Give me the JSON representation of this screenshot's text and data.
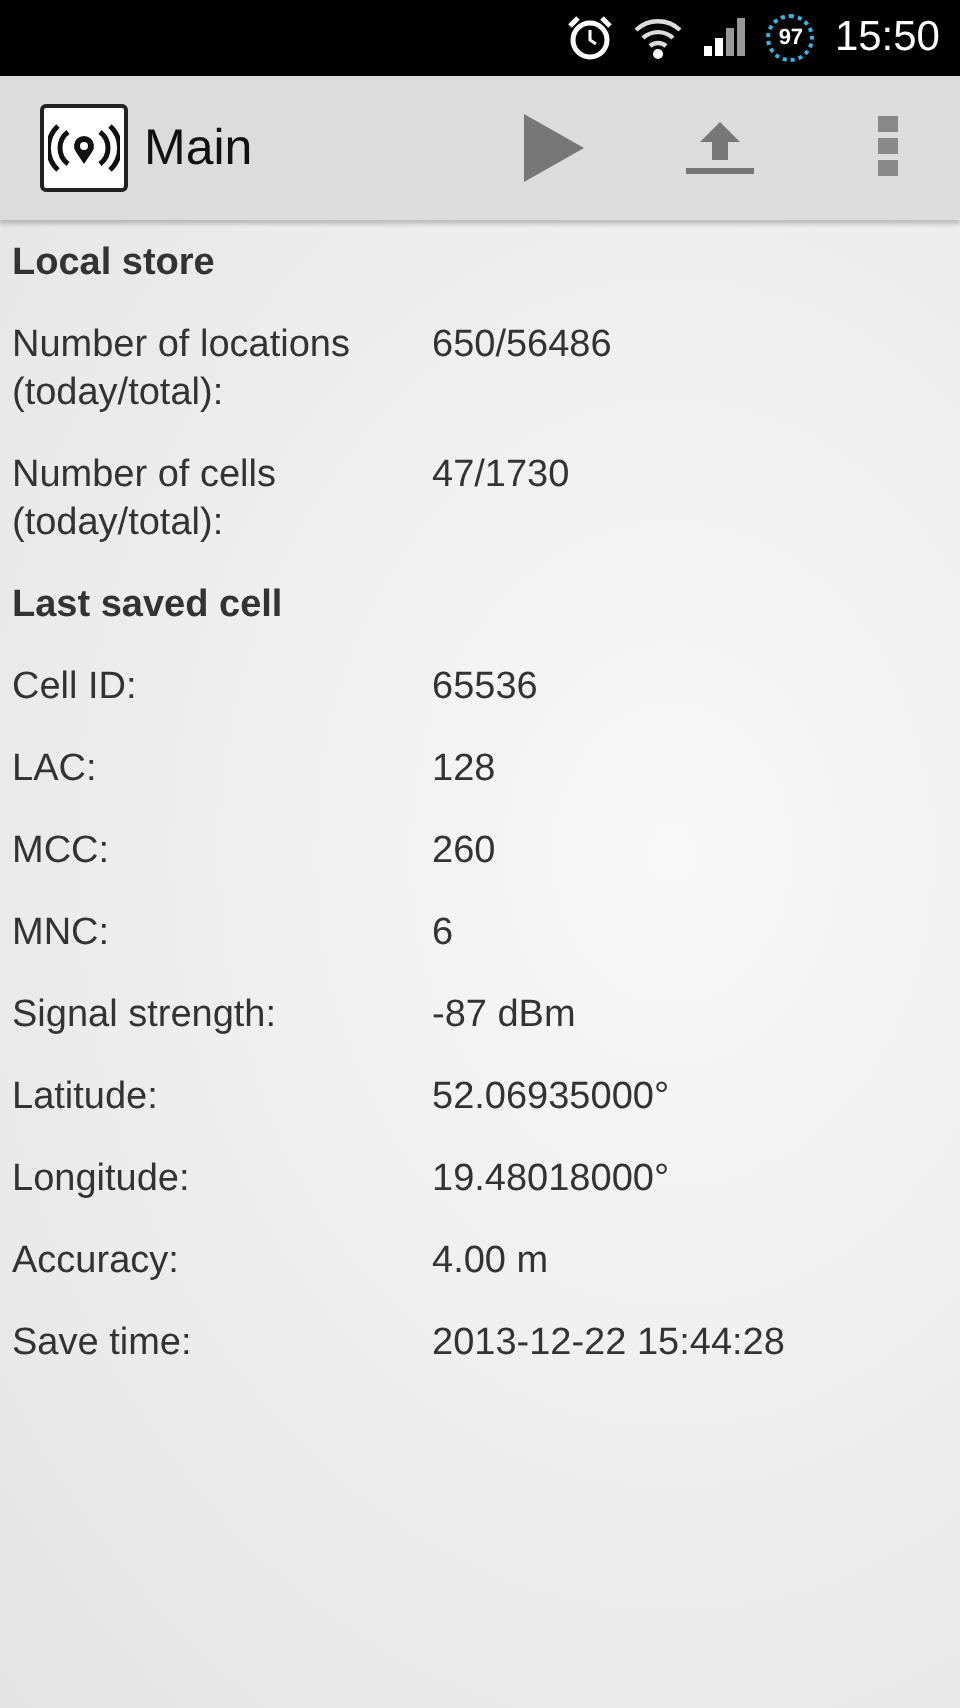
{
  "status_bar": {
    "battery": "97",
    "time": "15:50"
  },
  "action_bar": {
    "title": "Main"
  },
  "sections": [
    {
      "title": "Local store",
      "rows": [
        {
          "label": "Number of locations (today/total):",
          "value": "650/56486"
        },
        {
          "label": "Number of cells (today/total):",
          "value": "47/1730"
        }
      ]
    },
    {
      "title": "Last saved cell",
      "rows": [
        {
          "label": "Cell ID:",
          "value": "65536"
        },
        {
          "label": "LAC:",
          "value": "128"
        },
        {
          "label": "MCC:",
          "value": "260"
        },
        {
          "label": "MNC:",
          "value": "6"
        },
        {
          "label": "Signal strength:",
          "value": "-87 dBm"
        },
        {
          "label": "Latitude:",
          "value": "52.06935000°"
        },
        {
          "label": "Longitude:",
          "value": "19.48018000°"
        },
        {
          "label": "Accuracy:",
          "value": "4.00 m"
        },
        {
          "label": "Save time:",
          "value": "2013-12-22 15:44:28"
        }
      ]
    }
  ]
}
